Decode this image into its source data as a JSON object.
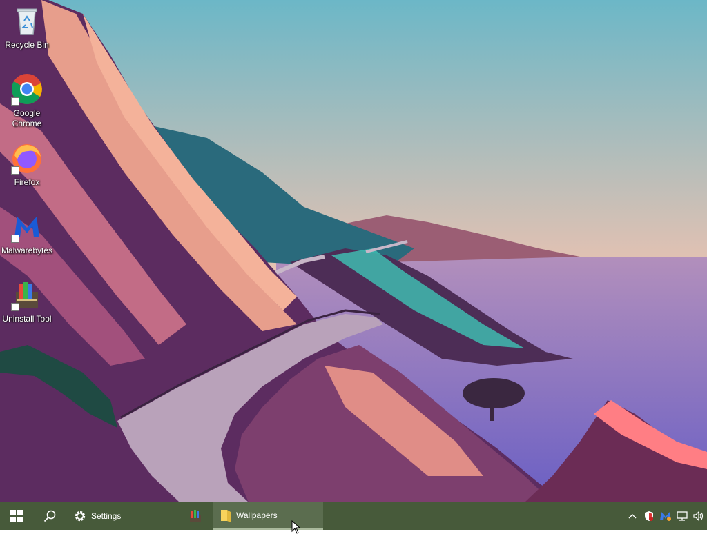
{
  "desktop": {
    "icons": [
      {
        "label": "Recycle Bin",
        "icon": "recycle-bin-icon"
      },
      {
        "label": "Google Chrome",
        "icon": "chrome-icon"
      },
      {
        "label": "Firefox",
        "icon": "firefox-icon"
      },
      {
        "label": "Malwarebytes",
        "icon": "malwarebytes-icon"
      },
      {
        "label": "Uninstall Tool",
        "icon": "uninstall-tool-icon"
      }
    ]
  },
  "taskbar": {
    "start_icon": "windows-start-icon",
    "search_icon": "search-icon",
    "apps": [
      {
        "label": "Settings",
        "icon": "gear-icon"
      },
      {
        "label": "",
        "icon": "uninstall-tool-icon"
      },
      {
        "label": "Wallpapers",
        "icon": "folder-icon",
        "active": true
      }
    ],
    "tray": [
      "chevron-up-icon",
      "security-shield-icon",
      "malwarebytes-tray-icon",
      "network-icon",
      "volume-icon"
    ]
  },
  "colors": {
    "taskbar_bg": "#475a3a",
    "sky_top": "#6fb6c6",
    "sky_bottom": "#f0b8a0",
    "sea": "#8a7fd0"
  }
}
